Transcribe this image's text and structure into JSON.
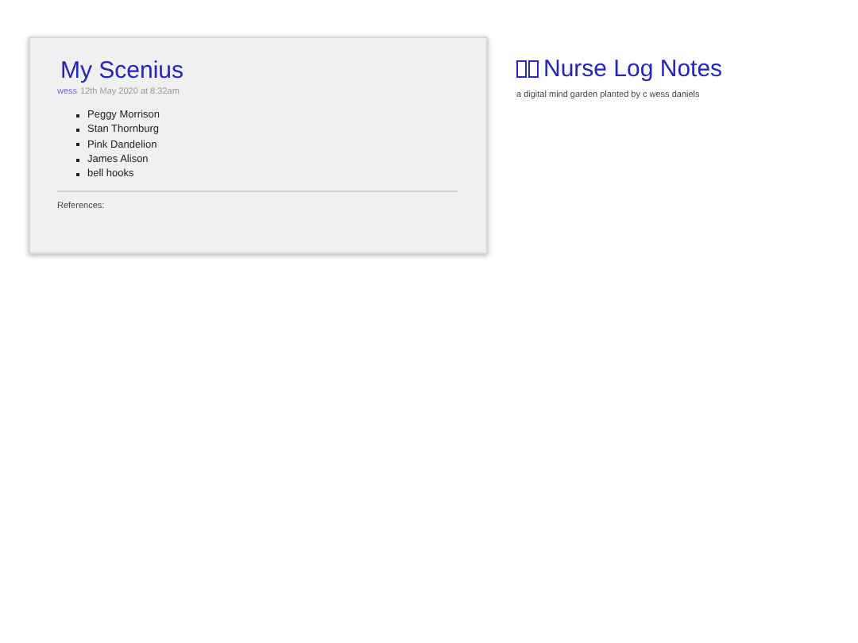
{
  "post": {
    "title": "My Scenius",
    "author": "wess",
    "date": "12th May 2020 at 8:32am",
    "items": [
      "Peggy Morrison",
      "Stan Thornburg",
      "Pink Dandelion",
      "James Alison",
      "bell hooks"
    ],
    "references_label": "References:"
  },
  "site": {
    "title": "Nurse Log Notes",
    "subtitle": "a digital mind garden planted by c wess daniels"
  }
}
